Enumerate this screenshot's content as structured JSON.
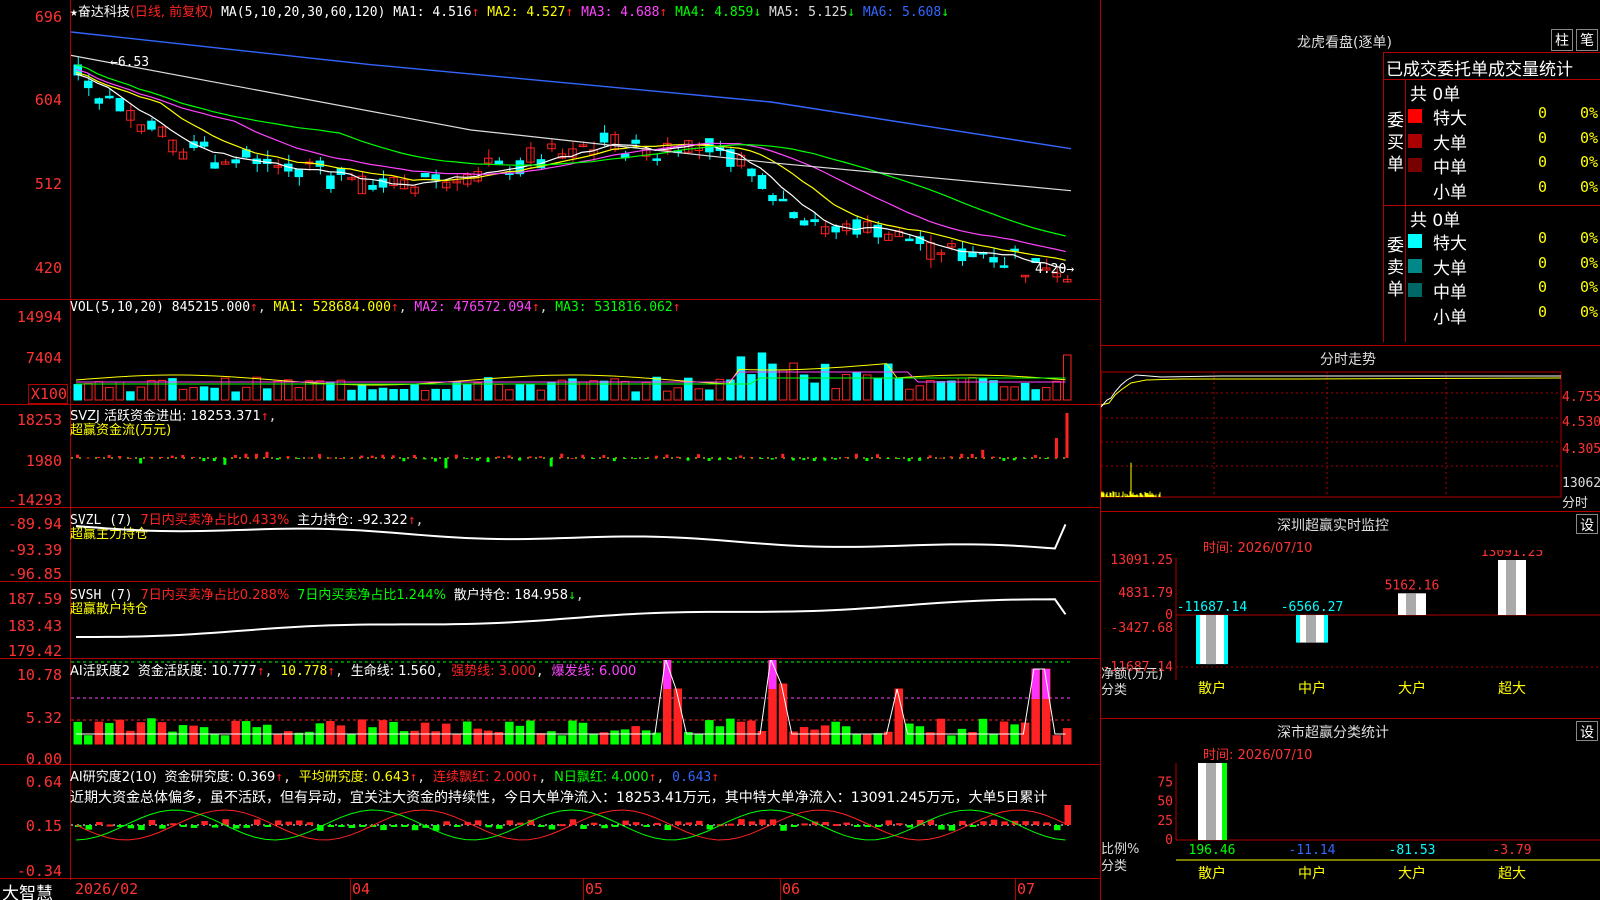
{
  "stock": {
    "name": "奋达科技",
    "mode": "(日线, 前复权)",
    "star": "★"
  },
  "price_panel": {
    "y_labels": [
      "696",
      "604",
      "512",
      "420"
    ],
    "ma_header": "MA(5,10,20,30,60,120)",
    "ma": [
      {
        "label": "MA1:",
        "value": "4.516",
        "arrow": "↑",
        "color": "#ffffff"
      },
      {
        "label": "MA2:",
        "value": "4.527",
        "arrow": "↑",
        "color": "#ffff00"
      },
      {
        "label": "MA3:",
        "value": "4.688",
        "arrow": "↑",
        "color": "#ff44ff"
      },
      {
        "label": "MA4:",
        "value": "4.859",
        "arrow": "↓",
        "color": "#00ff00"
      },
      {
        "label": "MA5:",
        "value": "5.125",
        "arrow": "↓",
        "color": "#dddddd"
      },
      {
        "label": "MA6:",
        "value": "5.608",
        "arrow": "↓",
        "color": "#3366ff"
      }
    ],
    "high_note": "6.53",
    "low_note": "4.20"
  },
  "vol_panel": {
    "y_labels": [
      "14994",
      "7404",
      "X100"
    ],
    "header": "VOL(5,10,20)",
    "value": "845215.000",
    "ma1": "MA1: 528684.000",
    "ma2": "MA2: 476572.094",
    "ma3": "MA3: 531816.062"
  },
  "svzj_panel": {
    "y_labels": [
      "18253",
      "1980",
      "-14293"
    ],
    "header": "SVZJ  活跃资金进出: 18253.371",
    "sub": "超赢资金流(万元)"
  },
  "svzl_panel": {
    "y_labels": [
      "-89.94",
      "-93.39",
      "-96.85"
    ],
    "header": "SVZL (7)",
    "pct": "7日内买卖净占比0.433%",
    "hold": "主力持仓: -92.322",
    "sub": "超赢主力持仓"
  },
  "svsh_panel": {
    "y_labels": [
      "187.59",
      "183.43",
      "179.42"
    ],
    "header": "SVSH (7)",
    "pct1": "7日内买卖净占比0.288%",
    "pct2": "7日内买卖净占比1.244%",
    "hold": "散户持仓: 184.958",
    "sub": "超赢散户持仓"
  },
  "ai_active": {
    "y_labels": [
      "10.78",
      "5.32",
      "0.00"
    ],
    "header": "AI活跃度2",
    "a": "资金活跃度: 10.777",
    "b": "10.778",
    "c": "生命线: 1.560",
    "d": "强势线: 3.000",
    "e": "爆发线: 6.000"
  },
  "ai_research": {
    "y_labels": [
      "0.64",
      "0.15",
      "-0.34"
    ],
    "header": "AI研究度2(10)",
    "a": "资金研究度: 0.369",
    "b": "平均研究度: 0.643",
    "c": "连续飘红: 2.000",
    "d": "N日飘红: 4.000",
    "e": "0.643",
    "comment": "近期大资金总体偏多，虽不活跃，但有异动，宜关注大资金的持续性，今日大单净流入：18253.41万元，其中特大单净流入：13091.245万元，大单5日累计"
  },
  "x_axis": {
    "labels": [
      "2026/02",
      "04",
      "05",
      "06",
      "07"
    ],
    "brand": "大智慧"
  },
  "dragon_tiger": {
    "title": "龙虎看盘(逐单)",
    "btn1": "柱",
    "btn2": "笔",
    "subtitle": "已成交委托单成交量统计",
    "buy_side": "委买单",
    "sell_side": "委卖单",
    "buy_total": "共 0单",
    "sell_total": "共 0单",
    "buy_rows": [
      {
        "label": "特大",
        "count": "0",
        "pct": "0%",
        "color": "#ff0000"
      },
      {
        "label": "大单",
        "count": "0",
        "pct": "0%",
        "color": "#aa0000"
      },
      {
        "label": "中单",
        "count": "0",
        "pct": "0%",
        "color": "#770000"
      },
      {
        "label": "小单",
        "count": "0",
        "pct": "0%",
        "color": "#000000"
      }
    ],
    "sell_rows": [
      {
        "label": "特大",
        "count": "0",
        "pct": "0%",
        "color": "#00ffff"
      },
      {
        "label": "大单",
        "count": "0",
        "pct": "0%",
        "color": "#008888"
      },
      {
        "label": "中单",
        "count": "0",
        "pct": "0%",
        "color": "#006666"
      },
      {
        "label": "小单",
        "count": "0",
        "pct": "0%",
        "color": "#000000"
      }
    ]
  },
  "intraday": {
    "title": "分时走势",
    "y_labels": [
      "4.755",
      "4.530",
      "4.305"
    ],
    "vol_label": "13062",
    "unit": "分时"
  },
  "sz_monitor": {
    "title": "深圳超赢实时监控",
    "btn": "设",
    "time": "时间: 2026/07/10",
    "y_labels": [
      "13091.25",
      "4831.79",
      "0",
      "-3427.68",
      "-11687.14"
    ],
    "ylabel": "净额(万元)",
    "xcat": "分类",
    "chart_data": {
      "type": "bar",
      "categories": [
        "散户",
        "中户",
        "大户",
        "超大"
      ],
      "values": [
        -11687.14,
        -6566.27,
        5162.16,
        13091.25
      ],
      "ylim": [
        -11687.14,
        13091.25
      ]
    },
    "value_labels": [
      "-11687.14",
      "-6566.27",
      "5162.16",
      "13091.25"
    ]
  },
  "sz_class": {
    "title": "深市超赢分类统计",
    "btn": "设",
    "time": "时间: 2026/07/10",
    "y_labels": [
      "75",
      "50",
      "25",
      "0"
    ],
    "ylabel": "比例%",
    "xcat": "分类",
    "chart_data": {
      "type": "bar",
      "categories": [
        "散户",
        "中户",
        "大户",
        "超大"
      ],
      "values": [
        196.46,
        -11.14,
        -81.53,
        -3.79
      ],
      "ylim": [
        0,
        100
      ]
    },
    "value_labels": [
      "196.46",
      "-11.14",
      "-81.53",
      "-3.79"
    ]
  }
}
